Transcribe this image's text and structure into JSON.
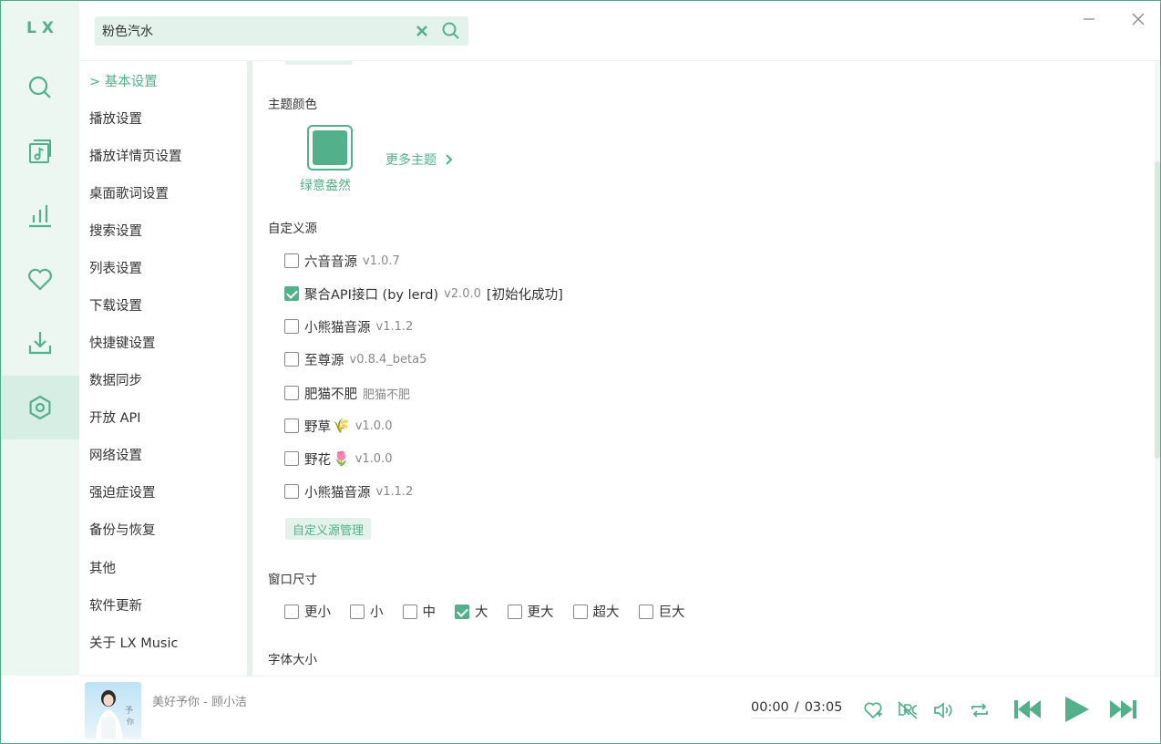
{
  "app": {
    "logo": "LX"
  },
  "colors": {
    "accent": "#52b08a",
    "accent_light": "#e3f2ea",
    "rail_bg": "#ecf7f2"
  },
  "rail": [
    {
      "icon": "search-icon",
      "active": false
    },
    {
      "icon": "music-list-icon",
      "active": false
    },
    {
      "icon": "chart-icon",
      "active": false
    },
    {
      "icon": "heart-icon",
      "active": false
    },
    {
      "icon": "download-icon",
      "active": false
    },
    {
      "icon": "settings-icon",
      "active": true
    }
  ],
  "search": {
    "value": "粉色汽水",
    "placeholder": ""
  },
  "nav": {
    "active_marker": ">",
    "items": [
      "基本设置",
      "播放设置",
      "播放详情页设置",
      "桌面歌词设置",
      "搜索设置",
      "列表设置",
      "下载设置",
      "快捷键设置",
      "数据同步",
      "开放 API",
      "网络设置",
      "强迫症设置",
      "备份与恢复",
      "其他",
      "软件更新",
      "关于 LX Music"
    ]
  },
  "theme": {
    "title": "主题颜色",
    "current_name": "绿意盎然",
    "current_color": "#52b08a",
    "more_label": "更多主题"
  },
  "sources": {
    "title": "自定义源",
    "items": [
      {
        "name": "六音音源",
        "version": "v1.0.7",
        "checked": false,
        "emoji": "",
        "status": ""
      },
      {
        "name": "聚合API接口 (by lerd)",
        "version": "v2.0.0",
        "checked": true,
        "emoji": "",
        "status": "[初始化成功]"
      },
      {
        "name": "小熊猫音源",
        "version": "v1.1.2",
        "checked": false,
        "emoji": "",
        "status": ""
      },
      {
        "name": "至尊源",
        "version": "v0.8.4_beta5",
        "checked": false,
        "emoji": "",
        "status": ""
      },
      {
        "name": "肥猫不肥",
        "version": "肥猫不肥",
        "checked": false,
        "emoji": "",
        "status": ""
      },
      {
        "name": "野草",
        "version": "v1.0.0",
        "checked": false,
        "emoji": "🌾",
        "status": ""
      },
      {
        "name": "野花",
        "version": "v1.0.0",
        "checked": false,
        "emoji": "🌷",
        "status": ""
      },
      {
        "name": "小熊猫音源",
        "version": "v1.1.2",
        "checked": false,
        "emoji": "",
        "status": ""
      }
    ],
    "manage_label": "自定义源管理"
  },
  "window_size": {
    "title": "窗口尺寸",
    "options": [
      {
        "label": "更小",
        "checked": false
      },
      {
        "label": "小",
        "checked": false
      },
      {
        "label": "中",
        "checked": false
      },
      {
        "label": "大",
        "checked": true
      },
      {
        "label": "更大",
        "checked": false
      },
      {
        "label": "超大",
        "checked": false
      },
      {
        "label": "巨大",
        "checked": false
      }
    ]
  },
  "font_size": {
    "title": "字体大小"
  },
  "player": {
    "song": "美好予你 - 顾小洁",
    "current_time": "00:00",
    "separator": "/",
    "total_time": "03:05"
  }
}
